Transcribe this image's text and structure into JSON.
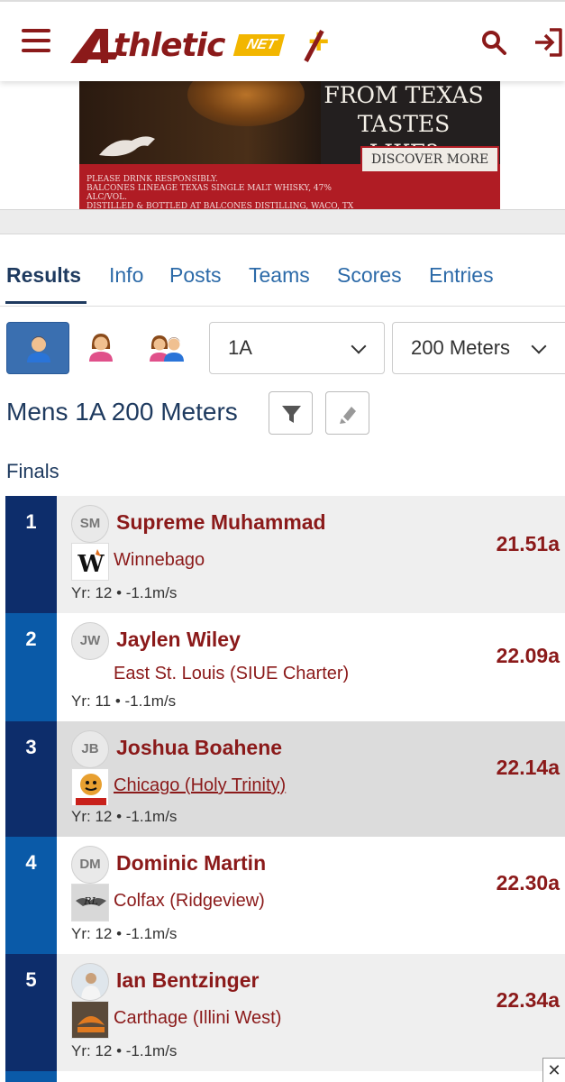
{
  "header": {
    "logo_text": "thletic",
    "logo_net": "NET",
    "logo_plus": "+"
  },
  "ad": {
    "headline": "FROM TEXAS TASTES LIKE?",
    "cta": "DISCOVER MORE",
    "legal_line1": "PLEASE DRINK RESPONSIBLY.",
    "legal_line2": "BALCONES LINEAGE TEXAS SINGLE MALT WHISKY, 47% ALC/VOL.",
    "legal_line3": "DISTILLED & BOTTLED AT BALCONES DISTILLING, WACO, TX"
  },
  "tabs": [
    "Results",
    "Info",
    "Posts",
    "Teams",
    "Scores",
    "Entries"
  ],
  "filters": {
    "division": "1A",
    "event": "200 Meters"
  },
  "event_title": "Mens 1A 200 Meters",
  "round_label": "Finals",
  "colors": {
    "brand": "#8b1a1a",
    "navy": "#0d2d6b",
    "blue": "#0a5aa8",
    "accent": "#f2b600"
  },
  "results": [
    {
      "place": "1",
      "initials": "SM",
      "name": "Supreme Muhammad",
      "team": "Winnebago",
      "meta": "Yr: 12 • -1.1m/s",
      "mark": "21.51a"
    },
    {
      "place": "2",
      "initials": "JW",
      "name": "Jaylen Wiley",
      "team": "East St. Louis (SIUE Charter)",
      "meta": "Yr: 11 • -1.1m/s",
      "mark": "22.09a"
    },
    {
      "place": "3",
      "initials": "JB",
      "name": "Joshua Boahene",
      "team": "Chicago (Holy Trinity)",
      "meta": "Yr: 12 • -1.1m/s",
      "mark": "22.14a"
    },
    {
      "place": "4",
      "initials": "DM",
      "name": "Dominic Martin",
      "team": "Colfax (Ridgeview)",
      "meta": "Yr: 12 • -1.1m/s",
      "mark": "22.30a"
    },
    {
      "place": "5",
      "initials": "",
      "name": "Ian Bentzinger",
      "team": "Carthage (Illini West)",
      "meta": "Yr: 12 • -1.1m/s",
      "mark": "22.34a"
    }
  ],
  "close_label": "✕"
}
